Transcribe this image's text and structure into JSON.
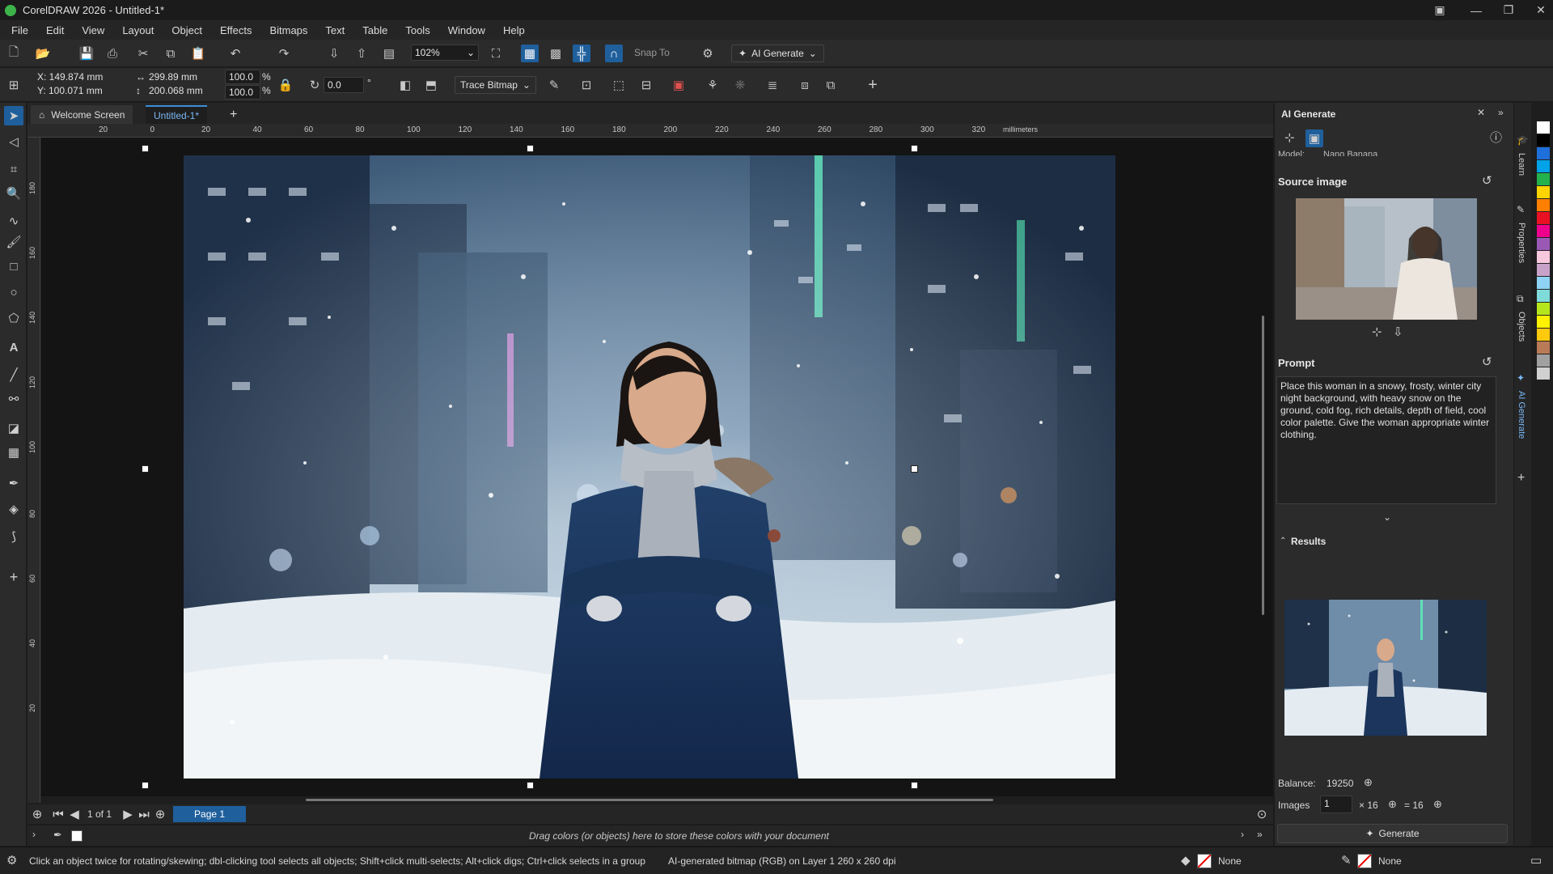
{
  "window": {
    "title": "CorelDRAW 2026 - Untitled-1*"
  },
  "menu": [
    "File",
    "Edit",
    "View",
    "Layout",
    "Object",
    "Effects",
    "Bitmaps",
    "Text",
    "Table",
    "Tools",
    "Window",
    "Help"
  ],
  "toolbar": {
    "zoom": "102%",
    "snap_to": "Snap To",
    "ai_generate": "AI Generate",
    "trace_bitmap": "Trace Bitmap"
  },
  "props": {
    "x": "X: 149.874 mm",
    "y": "Y: 100.071 mm",
    "width": "299.89 mm",
    "height": "200.068 mm",
    "scale_x": "100.0",
    "scale_y": "100.0",
    "pct": "%",
    "rotation": "0.0",
    "deg": "°"
  },
  "tabs": {
    "welcome": "Welcome Screen",
    "doc": "Untitled-1*"
  },
  "ruler": {
    "h": [
      "20",
      "0",
      "20",
      "40",
      "60",
      "80",
      "100",
      "120",
      "140",
      "160",
      "180",
      "200",
      "220",
      "240",
      "260",
      "280",
      "300",
      "320"
    ],
    "unit": "millimeters",
    "v": [
      "180",
      "160",
      "140",
      "120",
      "100",
      "80",
      "60",
      "40",
      "20"
    ],
    "vunit": "millimeters"
  },
  "pagenav": {
    "count": "1 of 1",
    "page": "Page 1"
  },
  "palette_hint": "Drag colors (or objects) here to store these colors with your document",
  "status": {
    "hint": "Click an object twice for rotating/skewing; dbl-clicking tool selects all objects; Shift+click multi-selects; Alt+click digs; Ctrl+click selects in a group",
    "object": "AI-generated bitmap (RGB) on Layer 1  260 x 260 dpi",
    "fill": "None",
    "outline": "None"
  },
  "panel": {
    "title": "AI Generate",
    "model_label": "Model:",
    "model_value": "Nano Banana",
    "source_title": "Source image",
    "prompt_title": "Prompt",
    "prompt_text": "Place this woman in a snowy, frosty, winter city night background, with heavy snow on the ground, cold fog, rich details, depth of field, cool color palette. Give the woman appropriate winter clothing.",
    "results_title": "Results",
    "balance_label": "Balance:",
    "balance_value": "19250",
    "images_label": "Images",
    "images_value": "1",
    "mult": "× 16",
    "equals": "= 16",
    "generate": "Generate"
  },
  "side_tabs": [
    "Learn",
    "Properties",
    "Objects",
    "AI Generate"
  ],
  "colors": {
    "accent": "#3b8ddb",
    "swatches": [
      "#ffffff",
      "#000000",
      "#1e6fd9",
      "#00a2e8",
      "#22b14c",
      "#ffd400",
      "#ff7f00",
      "#e81123",
      "#ec008c",
      "#9b59b6",
      "#f8c8dc",
      "#c8a2c8",
      "#8fd3f4",
      "#7fdbda",
      "#b5e61d",
      "#fff200",
      "#ffc90e",
      "#b97a57",
      "#a0a0a0",
      "#d0d0d0"
    ]
  }
}
